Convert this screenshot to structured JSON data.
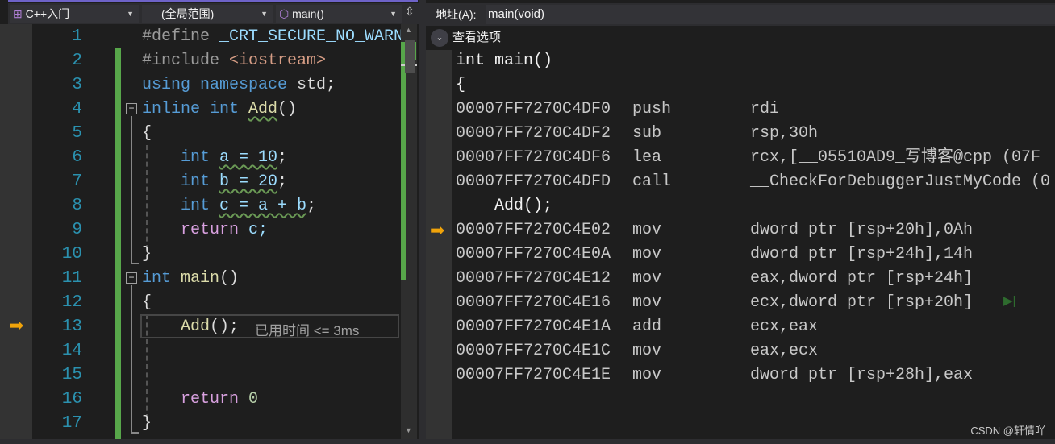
{
  "editor": {
    "nav": {
      "project": "C++入门",
      "scope": "(全局范围)",
      "member": "main()"
    },
    "line_numbers": [
      "1",
      "2",
      "3",
      "4",
      "5",
      "6",
      "7",
      "8",
      "9",
      "10",
      "11",
      "12",
      "13",
      "14",
      "15",
      "16",
      "17"
    ],
    "lines": {
      "l1a": "#define ",
      "l1b": "_CRT_SECURE_NO_WARN",
      "l2a": "#include ",
      "l2b": "<iostream>",
      "l3a": "using namespace ",
      "l3b": "std;",
      "l4a": "inline int ",
      "l4b": "Add",
      "l4c": "()",
      "l5": "{",
      "l6a": "    int ",
      "l6b": "a = 10",
      "l6c": ";",
      "l7a": "    int ",
      "l7b": "b = 20",
      "l7c": ";",
      "l8a": "    int ",
      "l8b": "c = a + b",
      "l8c": ";",
      "l9a": "    return ",
      "l9b": "c;",
      "l10": "}",
      "l11a": "int ",
      "l11b": "main",
      "l11c": "()",
      "l12": "{",
      "l13a": "    Add",
      "l13b": "();",
      "l16a": "    return ",
      "l16b": "0",
      ";": ";",
      "l17": "}"
    },
    "perf_tip": "已用时间 <= 3ms"
  },
  "disasm": {
    "address_label": "地址(A):",
    "address_value": "main(void)",
    "view_options": "查看选项",
    "rows": [
      {
        "src": "int main()"
      },
      {
        "src": "{"
      },
      {
        "addr": "00007FF7270C4DF0",
        "op": "push",
        "args": "rdi"
      },
      {
        "addr": "00007FF7270C4DF2",
        "op": "sub",
        "args": "rsp,30h"
      },
      {
        "addr": "00007FF7270C4DF6",
        "op": "lea",
        "args": "rcx,[__05510AD9_写博客@cpp (07F"
      },
      {
        "addr": "00007FF7270C4DFD",
        "op": "call",
        "args": "__CheckForDebuggerJustMyCode (0"
      },
      {
        "src": "    Add();"
      },
      {
        "addr": "00007FF7270C4E02",
        "op": "mov",
        "args": "dword ptr [rsp+20h],0Ah"
      },
      {
        "addr": "00007FF7270C4E0A",
        "op": "mov",
        "args": "dword ptr [rsp+24h],14h"
      },
      {
        "addr": "00007FF7270C4E12",
        "op": "mov",
        "args": "eax,dword ptr [rsp+24h]"
      },
      {
        "addr": "00007FF7270C4E16",
        "op": "mov",
        "args": "ecx,dword ptr [rsp+20h]"
      },
      {
        "addr": "00007FF7270C4E1A",
        "op": "add",
        "args": "ecx,eax"
      },
      {
        "addr": "00007FF7270C4E1C",
        "op": "mov",
        "args": "eax,ecx"
      },
      {
        "addr": "00007FF7270C4E1E",
        "op": "mov",
        "args": "dword ptr [rsp+28h],eax"
      }
    ]
  },
  "watermark": "CSDN @轩情吖",
  "colors": {
    "keyword": "#569cd6",
    "line_number": "#2b91af",
    "changed": "#57a64a",
    "current_arrow": "#f0a30a"
  }
}
